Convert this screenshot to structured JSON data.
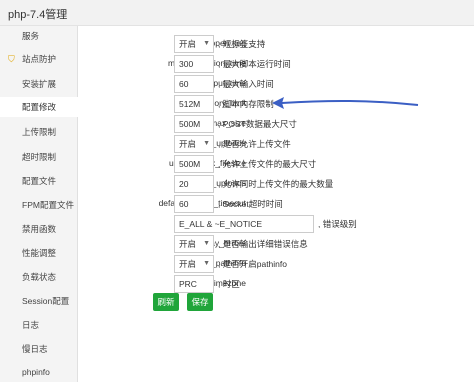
{
  "window": {
    "title": "php-7.4管理"
  },
  "sidebar": {
    "items": [
      {
        "label": "服务"
      },
      {
        "label": "站点防护"
      },
      {
        "label": "安装扩展"
      },
      {
        "label": "配置修改"
      },
      {
        "label": "上传限制"
      },
      {
        "label": "超时限制"
      },
      {
        "label": "配置文件"
      },
      {
        "label": "FPM配置文件"
      },
      {
        "label": "禁用函数"
      },
      {
        "label": "性能调整"
      },
      {
        "label": "负载状态"
      },
      {
        "label": "Session配置"
      },
      {
        "label": "日志"
      },
      {
        "label": "慢日志"
      },
      {
        "label": "phpinfo"
      }
    ],
    "active_index": 3,
    "shield_icon": "shield-icon",
    "accent_color": "#e0a400"
  },
  "settings": [
    {
      "key": "short_open_tag",
      "type": "select",
      "value": "开启",
      "desc": "短标签支持"
    },
    {
      "key": "max_execution_time",
      "type": "input",
      "value": "300",
      "desc": "最大脚本运行时间"
    },
    {
      "key": "max_input_time",
      "type": "input",
      "value": "60",
      "desc": "最大输入时间"
    },
    {
      "key": "memory_limit",
      "type": "input",
      "value": "512M",
      "desc": "脚本内存限制"
    },
    {
      "key": "post_max_size",
      "type": "input",
      "value": "500M",
      "desc": "POST数据最大尺寸"
    },
    {
      "key": "file_uploads",
      "type": "select",
      "value": "开启",
      "desc": "是否允许上传文件"
    },
    {
      "key": "upload_max_filesize",
      "type": "input",
      "value": "500M",
      "desc": "允许上传文件的最大尺寸"
    },
    {
      "key": "max_file_uploads",
      "type": "input",
      "value": "20",
      "desc": "允许同时上传文件的最大数量"
    },
    {
      "key": "default_socket_timeout",
      "type": "input",
      "value": "60",
      "desc": "Socket超时时间"
    },
    {
      "key": "error_reporting",
      "type": "input",
      "value": "E_ALL & ~E_NOTICE",
      "desc": "错误级别"
    },
    {
      "key": "display_errors",
      "type": "select",
      "value": "开启",
      "desc": "是否输出详细错误信息"
    },
    {
      "key": "cgi.fix_pathinfo",
      "type": "select",
      "value": "开启",
      "desc": "是否开启pathinfo"
    },
    {
      "key": "date.timezone",
      "type": "input",
      "value": "PRC",
      "desc": "时区"
    }
  ],
  "buttons": {
    "refresh": "刷新",
    "save": "保存"
  },
  "annotation": {
    "arrow_color": "#3b5fc4"
  },
  "colors": {
    "primary_button": "#20a53a"
  }
}
